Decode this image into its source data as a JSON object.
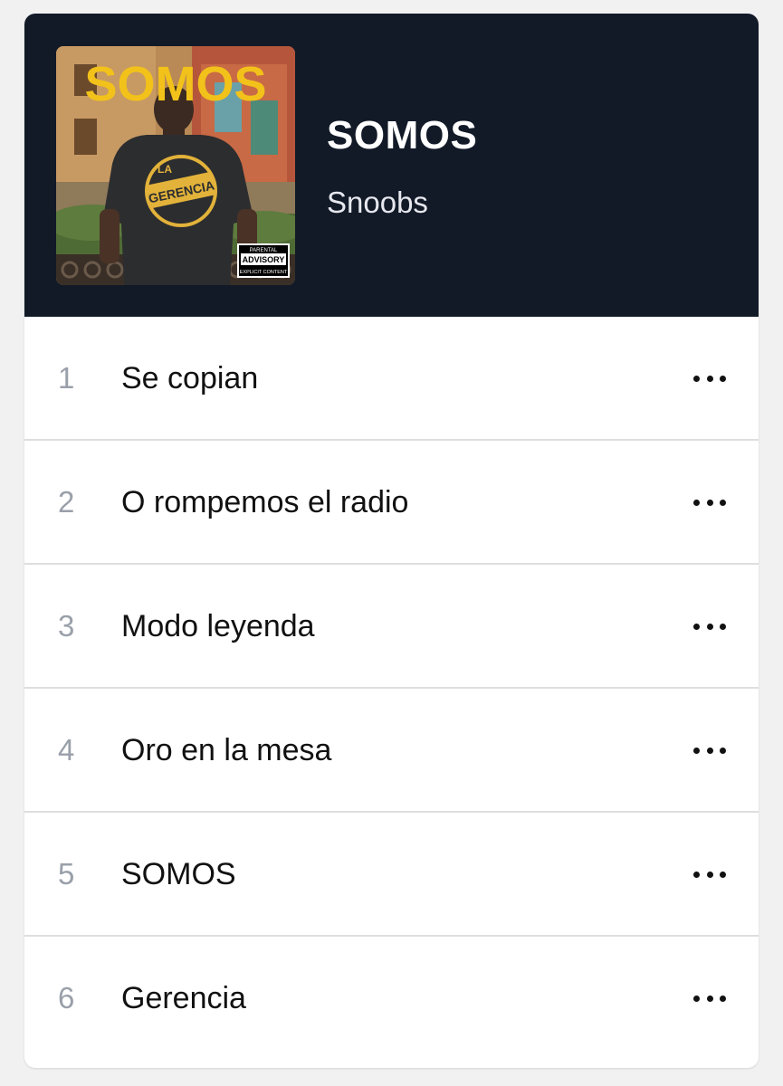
{
  "album": {
    "title": "SOMOS",
    "artist": "Snoobs",
    "cover_text": {
      "title": "SOMOS",
      "shirt_logo_top": "LA",
      "shirt_logo_main": "GERENCIA",
      "advisory_top": "PARENTAL",
      "advisory_mid": "ADVISORY",
      "advisory_bottom": "EXPLICIT CONTENT"
    }
  },
  "colors": {
    "header_bg": "#121a28",
    "page_bg": "#f1f1f1",
    "cover_title": "#f2c21a"
  },
  "tracks": [
    {
      "number": "1",
      "title": "Se copian",
      "menu_icon": "more-horizontal-icon"
    },
    {
      "number": "2",
      "title": "O rompemos el radio",
      "menu_icon": "more-horizontal-icon"
    },
    {
      "number": "3",
      "title": "Modo leyenda",
      "menu_icon": "more-horizontal-icon"
    },
    {
      "number": "4",
      "title": "Oro en la mesa",
      "menu_icon": "more-horizontal-icon"
    },
    {
      "number": "5",
      "title": "SOMOS",
      "menu_icon": "more-horizontal-icon"
    },
    {
      "number": "6",
      "title": "Gerencia",
      "menu_icon": "more-horizontal-icon"
    }
  ]
}
